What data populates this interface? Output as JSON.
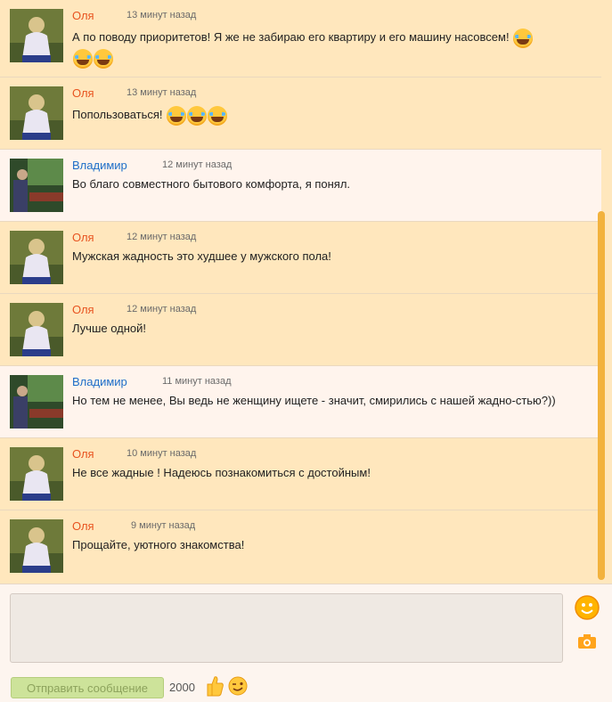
{
  "messages": [
    {
      "author": "Оля",
      "time": "13 минут назад",
      "text": "А по поводу приоритетов! Я же не забираю его квартиру и его машину насовсем!",
      "emoji_count": 3,
      "side": "in"
    },
    {
      "author": "Оля",
      "time": "13 минут назад",
      "text": "Попользоваться!",
      "emoji_count": 3,
      "side": "in"
    },
    {
      "author": "Владимир",
      "time": "12 минут назад",
      "text": "Во благо совместного бытового комфорта, я понял.",
      "emoji_count": 0,
      "side": "out"
    },
    {
      "author": "Оля",
      "time": "12 минут назад",
      "text": "Мужская жадность это худшее у мужского пола!",
      "emoji_count": 0,
      "side": "in"
    },
    {
      "author": "Оля",
      "time": "12 минут назад",
      "text": "Лучше одной!",
      "emoji_count": 0,
      "side": "in"
    },
    {
      "author": "Владимир",
      "time": "11 минут назад",
      "text": "Но тем не менее, Вы ведь не женщину ищете - значит, смирились с нашей жадно-стью?))",
      "emoji_count": 0,
      "side": "out"
    },
    {
      "author": "Оля",
      "time": "10 минут назад",
      "text": "Не все жадные ! Надеюсь познакомиться с достойным!",
      "emoji_count": 0,
      "side": "in"
    },
    {
      "author": "Оля",
      "time": "9 минут назад",
      "text": "Прощайте, уютного знакомства!",
      "emoji_count": 0,
      "side": "in"
    }
  ],
  "composer": {
    "placeholder": "",
    "send_label": "Отправить сообщение",
    "char_counter": "2000"
  },
  "icons": {
    "emoji": "laughing-tears-emoji",
    "smile": "smile-icon",
    "photo": "camera-icon",
    "like": "thumbs-up-icon",
    "wink": "wink-icon"
  },
  "colors": {
    "incoming_bg": "#ffe7bd",
    "outgoing_bg": "#fff4ed",
    "author_olya": "#e8531f",
    "author_vlad": "#1e6ec8",
    "send_button": "#cde39a"
  }
}
